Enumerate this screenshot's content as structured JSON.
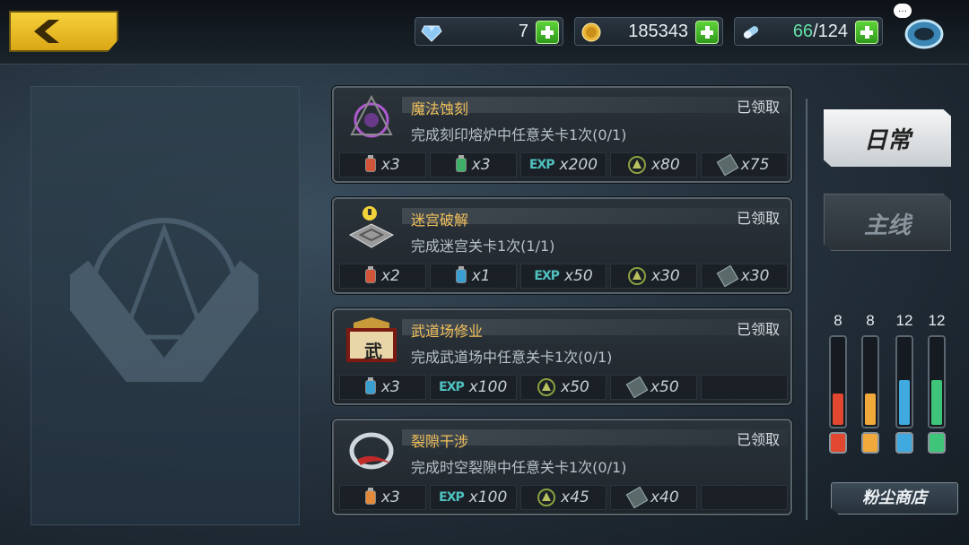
{
  "resources": {
    "gems": {
      "icon": "diamond-icon",
      "value": "7"
    },
    "gold": {
      "icon": "coin-icon",
      "value": "185343"
    },
    "stamina": {
      "icon": "stamina-capsule-icon",
      "current": "66",
      "sep": "/",
      "max": "124"
    }
  },
  "tabs": [
    {
      "label": "日常",
      "active": true
    },
    {
      "label": "主线",
      "active": false
    }
  ],
  "quests": [
    {
      "title": "魔法蚀刻",
      "status": "已领取",
      "desc": "完成刻印熔炉中任意关卡1次(0/1)",
      "icon": "magic-etch-icon",
      "rewards": [
        {
          "kind": "vial-red",
          "label": "x3"
        },
        {
          "kind": "vial-green",
          "label": "x3"
        },
        {
          "kind": "exp",
          "tag": "EXP",
          "label": "x200"
        },
        {
          "kind": "rune",
          "label": "x80"
        },
        {
          "kind": "scroll",
          "label": "x75"
        }
      ]
    },
    {
      "title": "迷宫破解",
      "status": "已领取",
      "desc": "完成迷宫关卡1次(1/1)",
      "icon": "maze-icon",
      "rewards": [
        {
          "kind": "vial-red",
          "label": "x2"
        },
        {
          "kind": "vial-blue",
          "label": "x1"
        },
        {
          "kind": "exp",
          "tag": "EXP",
          "label": "x50"
        },
        {
          "kind": "rune",
          "label": "x30"
        },
        {
          "kind": "scroll",
          "label": "x30"
        }
      ]
    },
    {
      "title": "武道场修业",
      "status": "已领取",
      "desc": "完成武道场中任意关卡1次(0/1)",
      "icon": "dojo-icon",
      "icon_text": "武",
      "rewards": [
        {
          "kind": "vial-blue",
          "label": "x3"
        },
        {
          "kind": "exp",
          "tag": "EXP",
          "label": "x100"
        },
        {
          "kind": "rune",
          "label": "x50"
        },
        {
          "kind": "scroll",
          "label": "x50"
        },
        {
          "kind": "empty",
          "label": ""
        }
      ]
    },
    {
      "title": "裂隙干涉",
      "status": "已领取",
      "desc": "完成时空裂隙中任意关卡1次(0/1)",
      "icon": "rift-icon",
      "rewards": [
        {
          "kind": "vial-orange",
          "label": "x3"
        },
        {
          "kind": "exp",
          "tag": "EXP",
          "label": "x100"
        },
        {
          "kind": "rune",
          "label": "x45"
        },
        {
          "kind": "scroll",
          "label": "x40"
        },
        {
          "kind": "empty",
          "label": ""
        }
      ]
    }
  ],
  "gauges": [
    {
      "count": "8",
      "fill_percent": 35,
      "color": "#e2472f"
    },
    {
      "count": "8",
      "fill_percent": 35,
      "color": "#f0a93a"
    },
    {
      "count": "12",
      "fill_percent": 50,
      "color": "#3fa9e0"
    },
    {
      "count": "12",
      "fill_percent": 50,
      "color": "#3fc57a"
    }
  ],
  "shop": {
    "label": "粉尘商店"
  }
}
